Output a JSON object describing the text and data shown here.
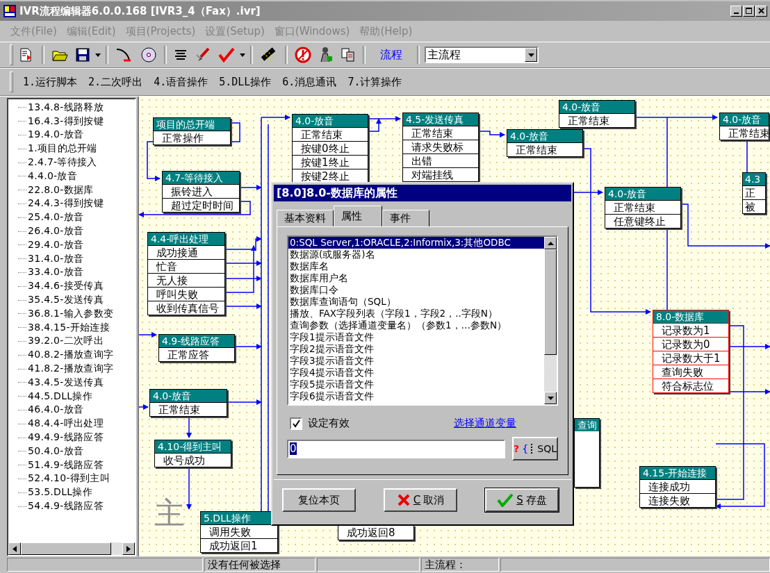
{
  "window": {
    "title": "IVR流程编辑器6.0.0.168 [IVR3_4（Fax）.ivr]"
  },
  "menu": [
    {
      "label": "文件(File)"
    },
    {
      "label": "编辑(Edit)"
    },
    {
      "label": "项目(Projects)"
    },
    {
      "label": "设置(Setup)"
    },
    {
      "label": "窗口(Windows)"
    },
    {
      "label": "帮助(Help)"
    }
  ],
  "toolbar": {
    "flow_label": "流程",
    "flow_combo": {
      "value": "主流程"
    }
  },
  "module_bar": [
    "1.运行脚本",
    "2.二次呼出",
    "4.语音操作",
    "5.DLL操作",
    "6.消息通讯",
    "7.计算操作"
  ],
  "tree": {
    "items": [
      "13.4.8-线路释放",
      "16.4.3-得到按键",
      "19.4.0-放音",
      "1.项目的总开端",
      "2.4.7-等待接入",
      "4.4.0-放音",
      "22.8.0-数据库",
      "24.4.3-得到按键",
      "25.4.0-放音",
      "26.4.0-放音",
      "29.4.0-放音",
      "31.4.0-放音",
      "33.4.0-放音",
      "34.4.6-接受传真",
      "35.4.5-发送传真",
      "36.8.1-输入参数变",
      "38.4.15-开始连接",
      "39.2.0-二次呼出",
      "40.8.2-播放查询字",
      "41.8.2-播放查询字",
      "43.4.5-发送传真",
      "44.5.DLL操作",
      "46.4.0-放音",
      "48.4.4-呼出处理",
      "49.4.9-线路应答",
      "50.4.0-放音",
      "51.4.9-线路应答",
      "52.4.10-得到主叫",
      "53.5.DLL操作",
      "54.4.9-线路应答"
    ]
  },
  "canvas": {
    "watermark": "主",
    "nodes": [
      {
        "title": "项目的总开端",
        "selected": false,
        "outputs": [
          "正常操作"
        ]
      },
      {
        "title": "4.7-等待接入",
        "selected": false,
        "outputs": [
          "振铃进入",
          "超过定时时间"
        ]
      },
      {
        "title": "4.4-呼出处理",
        "selected": false,
        "outputs": [
          "成功接通",
          "忙音",
          "无人接",
          "呼叫失败",
          "收到传真信号"
        ]
      },
      {
        "title": "4.9-线路应答",
        "selected": false,
        "outputs": [
          "正常应答"
        ]
      },
      {
        "title": "4.0-放音",
        "selected": false,
        "outputs": [
          "正常结束"
        ]
      },
      {
        "title": "4.10-得到主叫",
        "selected": false,
        "outputs": [
          "收号成功"
        ]
      },
      {
        "title": "5.DLL操作",
        "selected": false,
        "outputs": [
          "调用失败",
          "成功返回1"
        ]
      },
      {
        "title": "4.0-放音",
        "selected": false,
        "outputs": [
          "正常结束",
          "按键0终止",
          "按键1终止",
          "按键2终止"
        ]
      },
      {
        "title": "4.5-发送传真",
        "selected": false,
        "outputs": [
          "正常结束",
          "请求失败标",
          "出错",
          "对端挂线"
        ]
      },
      {
        "title": "4.0-放音",
        "selected": false,
        "outputs": [
          "正常结束"
        ]
      },
      {
        "title": "4.0-放音",
        "selected": false,
        "outputs": [
          "正常结束"
        ]
      },
      {
        "title": "4.0-放音",
        "selected": false,
        "outputs": [
          "正常结束"
        ]
      },
      {
        "title": "4.3",
        "selected": false,
        "outputs": [
          "正",
          "被"
        ]
      },
      {
        "title": "4.0-放音",
        "selected": false,
        "outputs": [
          "正常结束",
          "任意键终止"
        ]
      },
      {
        "title": "8.0-数据库",
        "selected": true,
        "outputs": [
          "记录数为1",
          "记录数为0",
          "记录数大于1",
          "查询失败",
          "符合标志位"
        ]
      },
      {
        "title": "4.15-开始连接",
        "selected": false,
        "outputs": [
          "连接成功",
          "连接失败"
        ]
      },
      {
        "title": "查询",
        "selected": false
      },
      {
        "selected": false,
        "outputs": [
          "成功返回8"
        ]
      }
    ]
  },
  "dialog": {
    "title": "[8.0]8.0-数据库的属性",
    "tabs": [
      {
        "label": "基本资料",
        "selected": false
      },
      {
        "label": "属性",
        "selected": true
      },
      {
        "label": "事件",
        "selected": false
      }
    ],
    "properties": [
      {
        "label": "0:SQL Server,1:ORACLE,2:Informix,3:其他ODBC",
        "selected": true
      },
      {
        "label": "数据源(或服务器)名",
        "selected": false
      },
      {
        "label": "数据库名",
        "selected": false
      },
      {
        "label": "数据库用户名",
        "selected": false
      },
      {
        "label": "数据库口令",
        "selected": false
      },
      {
        "label": "数据库查询语句（SQL）",
        "selected": false
      },
      {
        "label": "播放、FAX字段列表（字段1，字段2，..字段N）",
        "selected": false
      },
      {
        "label": "查询参数（选择通道变量名）（参数1，…参数N）",
        "selected": false
      },
      {
        "label": "字段1提示语音文件",
        "selected": false
      },
      {
        "label": "字段2提示语音文件",
        "selected": false
      },
      {
        "label": "字段3提示语音文件",
        "selected": false
      },
      {
        "label": "字段4提示语音文件",
        "selected": false
      },
      {
        "label": "字段5提示语音文件",
        "selected": false
      },
      {
        "label": "字段6提示语音文件",
        "selected": false
      }
    ],
    "valid_checkbox": {
      "label": "设定有效",
      "checked": true
    },
    "variable_link": "选择通道变量",
    "value_field": {
      "value": "0"
    },
    "sql_button": {
      "glyph": "?{",
      "label": "SQL"
    },
    "buttons": [
      {
        "kind": "reset",
        "label": "复位本页"
      },
      {
        "kind": "cancel",
        "accel": "C",
        "label": "取消"
      },
      {
        "kind": "save",
        "accel": "S",
        "label": "存盘"
      }
    ]
  },
  "status_bar": [
    {
      "text": "没有任何被选择"
    },
    {
      "text": "主流程："
    }
  ]
}
